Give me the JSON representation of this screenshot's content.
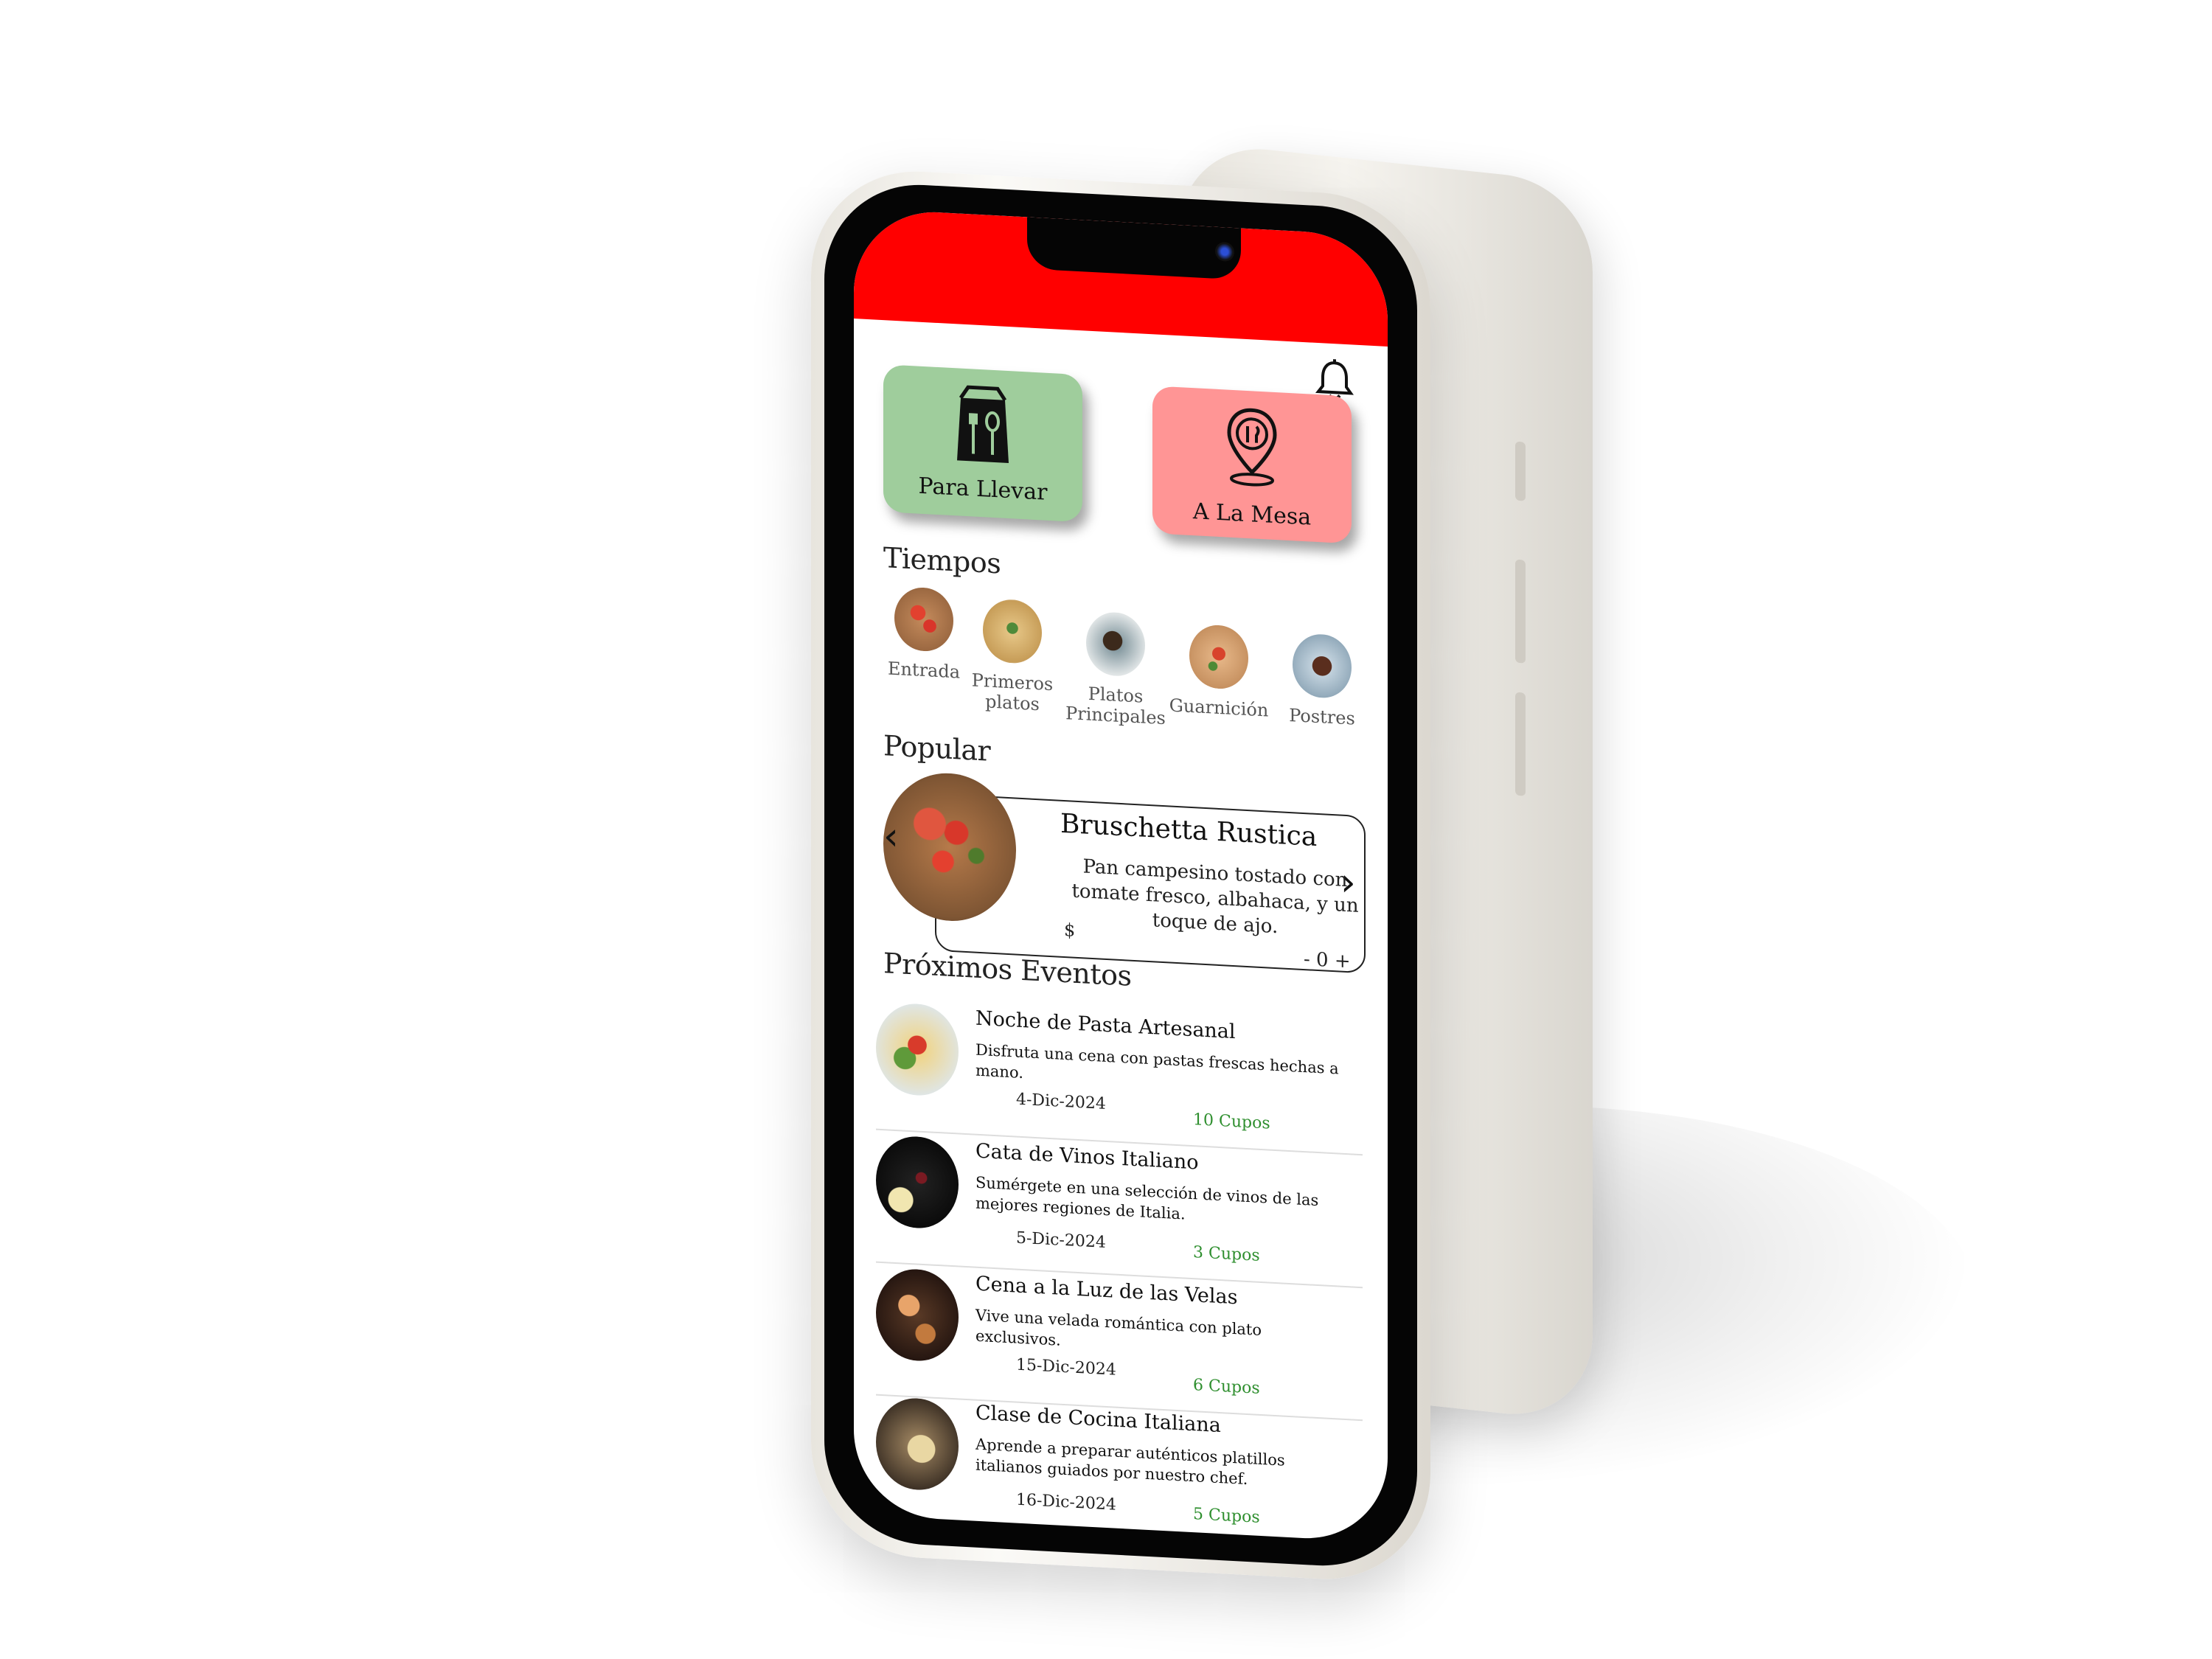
{
  "colors": {
    "status_bar": "#ff0000",
    "takeaway_bg": "#9fcd9c",
    "dine_in_bg": "#ff9595",
    "seats_text": "#2f8f2f"
  },
  "header": {
    "bell_icon": "bell-icon"
  },
  "modes": {
    "takeaway": {
      "label": "Para Llevar",
      "icon": "takeaway-bag-icon"
    },
    "dine_in": {
      "label": "A La Mesa",
      "icon": "location-cutlery-icon"
    }
  },
  "courses": {
    "title": "Tiempos",
    "items": [
      {
        "label": "Entrada"
      },
      {
        "label": "Primeros platos"
      },
      {
        "label": "Platos Principales"
      },
      {
        "label": "Guarnición"
      },
      {
        "label": "Postres"
      }
    ]
  },
  "popular": {
    "title": "Popular",
    "name": "Bruschetta Rustica",
    "description": "Pan campesino tostado con tomate fresco, albahaca, y un toque de ajo.",
    "price": "$",
    "quantity": "- 0 +"
  },
  "events": {
    "title": "Próximos Eventos",
    "items": [
      {
        "title": "Noche de Pasta Artesanal",
        "description": "Disfruta una cena con pastas frescas hechas a mano.",
        "date": "4-Dic-2024",
        "seats": "10 Cupos"
      },
      {
        "title": "Cata de Vinos Italiano",
        "description": "Sumérgete en una selección de vinos de las mejores regiones de Italia.",
        "date": "5-Dic-2024",
        "seats": "3 Cupos"
      },
      {
        "title": "Cena a la Luz de las Velas",
        "description": "Vive una velada romántica con plato exclusivos.",
        "date": "15-Dic-2024",
        "seats": "6 Cupos"
      },
      {
        "title": "Clase de Cocina Italiana",
        "description": "Aprende a preparar auténticos platillos italianos guiados por nuestro chef.",
        "date": "16-Dic-2024",
        "seats": "5 Cupos"
      }
    ]
  }
}
